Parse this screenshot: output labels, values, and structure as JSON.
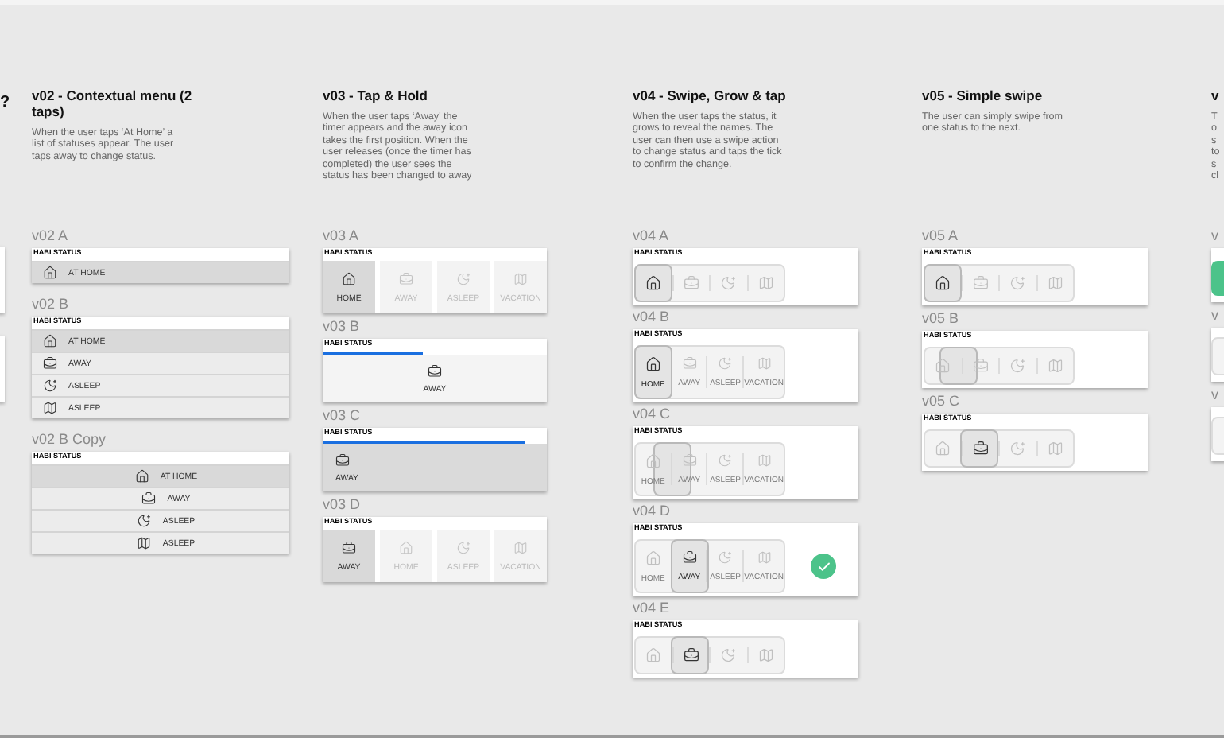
{
  "page_title": "?",
  "columns": [
    {
      "title": [
        "v02 - Contextual menu (2",
        "taps)"
      ],
      "description": [
        "When the user taps ‘At Home’ a",
        "list of statuses appear. The user",
        "taps away to change status."
      ],
      "artboards": [
        {
          "label": "v02 A",
          "header": "HABI STATUS",
          "kind": "menu",
          "centered": false,
          "items": [
            {
              "kind": "house",
              "text": "AT HOME",
              "selected": true
            }
          ]
        },
        {
          "label": "v02 B",
          "header": "HABI STATUS",
          "kind": "menu",
          "centered": false,
          "items": [
            {
              "kind": "house",
              "text": "AT HOME",
              "selected": true
            },
            {
              "kind": "briefcase",
              "text": "AWAY",
              "selected": false
            },
            {
              "kind": "moon",
              "text": "ASLEEP",
              "selected": false
            },
            {
              "kind": "map",
              "text": "ASLEEP",
              "selected": false
            }
          ]
        },
        {
          "label": "v02 B Copy",
          "header": "HABI STATUS",
          "kind": "menu",
          "centered": true,
          "items": [
            {
              "kind": "house",
              "text": "AT HOME",
              "selected": true
            },
            {
              "kind": "briefcase",
              "text": "AWAY",
              "selected": false
            },
            {
              "kind": "moon",
              "text": "ASLEEP",
              "selected": false
            },
            {
              "kind": "map",
              "text": "ASLEEP",
              "selected": false
            }
          ]
        }
      ]
    },
    {
      "title": [
        "v03 - Tap & Hold"
      ],
      "description": [
        "When the user taps ‘Away’ the",
        "timer appears and the away icon",
        "takes the first position. When the",
        "user releases (once the timer has",
        "completed) the user sees the",
        "status has been changed to away"
      ],
      "artboards": [
        {
          "label": "v03 A",
          "header": "HABI STATUS",
          "kind": "tiles",
          "items": [
            {
              "kind": "house",
              "text": "HOME",
              "selected": true
            },
            {
              "kind": "briefcase",
              "text": "AWAY",
              "selected": false
            },
            {
              "kind": "moon",
              "text": "ASLEEP",
              "selected": false
            },
            {
              "kind": "map",
              "text": "VACATION",
              "selected": false
            }
          ]
        },
        {
          "label": "v03 B",
          "header": "HABI STATUS",
          "kind": "timer",
          "level": 0.45,
          "selected": false,
          "item": {
            "kind": "briefcase",
            "text": "AWAY"
          }
        },
        {
          "label": "v03 C",
          "header": "HABI STATUS",
          "kind": "timer",
          "level": 0.9,
          "selected": true,
          "item": {
            "kind": "briefcase",
            "text": "AWAY"
          }
        },
        {
          "label": "v03 D",
          "header": "HABI STATUS",
          "kind": "tiles",
          "items": [
            {
              "kind": "briefcase",
              "text": "AWAY",
              "selected": true
            },
            {
              "kind": "house",
              "text": "HOME",
              "selected": false
            },
            {
              "kind": "moon",
              "text": "ASLEEP",
              "selected": false
            },
            {
              "kind": "map",
              "text": "VACATION",
              "selected": false
            }
          ]
        }
      ]
    },
    {
      "title": [
        "v04 - Swipe, Grow & tap"
      ],
      "description": [
        "When the user taps the status, it",
        "grows to reveal the names. The",
        "user can then use a swipe action",
        "to change status and taps the tick",
        "to confirm the change."
      ],
      "artboards": [
        {
          "label": "v04 A",
          "header": "HABI STATUS",
          "kind": "switch",
          "level": 0,
          "items": [
            {
              "kind": "house",
              "selected": true
            },
            {
              "kind": "briefcase",
              "selected": false
            },
            {
              "kind": "moon",
              "selected": false
            },
            {
              "kind": "map",
              "selected": false
            }
          ]
        },
        {
          "label": "v04 B",
          "header": "HABI STATUS",
          "kind": "switch",
          "level": 0,
          "items": [
            {
              "kind": "house",
              "text": "HOME",
              "selected": true
            },
            {
              "kind": "briefcase",
              "text": "AWAY",
              "selected": false
            },
            {
              "kind": "moon",
              "text": "ASLEEP",
              "selected": false
            },
            {
              "kind": "map",
              "text": "VACATION",
              "selected": false
            }
          ]
        },
        {
          "label": "v04 C",
          "header": "HABI STATUS",
          "kind": "switch",
          "level": 0.17,
          "items": [
            {
              "kind": "house",
              "text": "HOME",
              "selected": false
            },
            {
              "kind": "briefcase",
              "text": "AWAY",
              "selected": false
            },
            {
              "kind": "moon",
              "text": "ASLEEP",
              "selected": false
            },
            {
              "kind": "map",
              "text": "VACATION",
              "selected": false
            }
          ]
        },
        {
          "label": "v04 D",
          "header": "HABI STATUS",
          "kind": "switch",
          "level": 0.33,
          "confirm": true,
          "items": [
            {
              "kind": "house",
              "text": "HOME",
              "selected": false
            },
            {
              "kind": "briefcase",
              "text": "AWAY",
              "selected": true
            },
            {
              "kind": "moon",
              "text": "ASLEEP",
              "selected": false
            },
            {
              "kind": "map",
              "text": "VACATION",
              "selected": false
            }
          ]
        },
        {
          "label": "v04 E",
          "header": "HABI STATUS",
          "kind": "switch",
          "level": 0.33,
          "items": [
            {
              "kind": "house",
              "selected": false
            },
            {
              "kind": "briefcase",
              "selected": true
            },
            {
              "kind": "moon",
              "selected": false
            },
            {
              "kind": "map",
              "selected": false
            }
          ]
        }
      ]
    },
    {
      "title": [
        "v05 - Simple swipe"
      ],
      "description": [
        "The user can simply swipe from",
        "one status to the next."
      ],
      "artboards": [
        {
          "label": "v05 A",
          "header": "HABI STATUS",
          "kind": "switch",
          "level": 0,
          "items": [
            {
              "kind": "house",
              "selected": true
            },
            {
              "kind": "briefcase",
              "selected": false
            },
            {
              "kind": "moon",
              "selected": false
            },
            {
              "kind": "map",
              "selected": false
            }
          ]
        },
        {
          "label": "v05 B",
          "header": "HABI STATUS",
          "kind": "switch",
          "level": 0.14,
          "items": [
            {
              "kind": "house",
              "selected": false
            },
            {
              "kind": "briefcase",
              "selected": false
            },
            {
              "kind": "moon",
              "selected": false
            },
            {
              "kind": "map",
              "selected": false
            }
          ]
        },
        {
          "label": "v05 C",
          "header": "HABI STATUS",
          "kind": "switch",
          "level": 0.33,
          "items": [
            {
              "kind": "house",
              "selected": false
            },
            {
              "kind": "briefcase",
              "selected": true
            },
            {
              "kind": "moon",
              "selected": false
            },
            {
              "kind": "map",
              "selected": false
            }
          ]
        }
      ]
    },
    {
      "title": [
        "v"
      ],
      "description": [
        "T",
        "o",
        "s",
        "to",
        "s",
        "cl"
      ],
      "artboards": [
        {
          "label": "v",
          "kind": "edge",
          "selected": true
        },
        {
          "label": "v",
          "kind": "edge",
          "selected": false
        },
        {
          "label": "v",
          "kind": "edge",
          "selected": false
        }
      ]
    }
  ]
}
